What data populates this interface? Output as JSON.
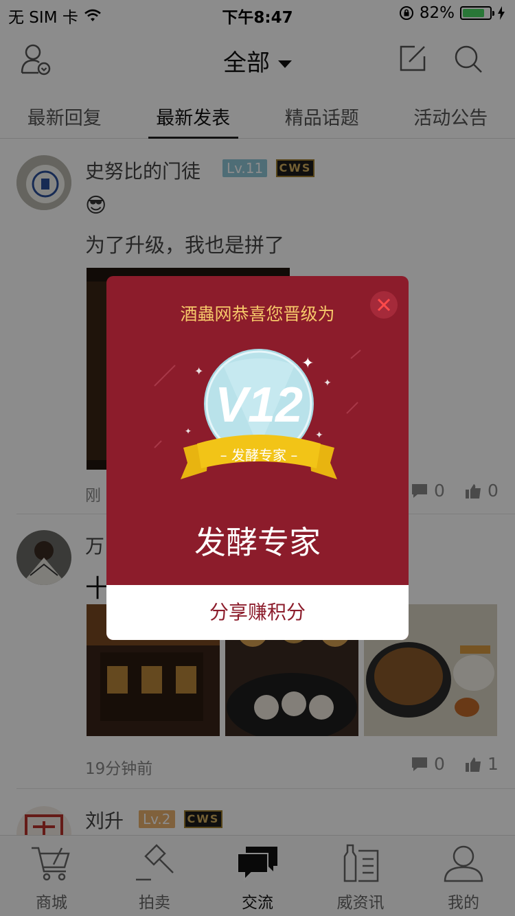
{
  "status_bar": {
    "carrier": "无 SIM 卡",
    "time": "下午8:47",
    "battery_text": "82%",
    "battery_level": 0.82,
    "icons": [
      "wifi-icon",
      "rotation-lock-icon",
      "battery-icon",
      "charging-icon"
    ]
  },
  "nav": {
    "title": "全部",
    "icons": [
      "user-icon",
      "edit-icon",
      "search-icon"
    ]
  },
  "tabs": [
    {
      "label": "最新回复",
      "active": false
    },
    {
      "label": "最新发表",
      "active": true
    },
    {
      "label": "精品话题",
      "active": false
    },
    {
      "label": "活动公告",
      "active": false
    }
  ],
  "posts": [
    {
      "username": "史努比的门徒",
      "level": "Lv.11",
      "badge": "CWS",
      "emoji": "😎",
      "text": "为了升级，我也是拼了",
      "time": "刚",
      "comments": "0",
      "likes": "0"
    },
    {
      "username": "万",
      "text": "十",
      "time": "19分钟前",
      "comments": "0",
      "likes": "1"
    },
    {
      "username": "刘升",
      "level": "Lv.2",
      "badge": "CWS"
    }
  ],
  "tabbar": [
    {
      "label": "商城",
      "icon": "cart-icon",
      "active": false
    },
    {
      "label": "拍卖",
      "icon": "gavel-icon",
      "active": false
    },
    {
      "label": "交流",
      "icon": "chat-icon",
      "active": true
    },
    {
      "label": "威资讯",
      "icon": "news-icon",
      "active": false
    },
    {
      "label": "我的",
      "icon": "profile-icon",
      "active": false
    }
  ],
  "modal": {
    "header": "酒蟲网恭喜您晋级为",
    "badge_level": "V12",
    "ribbon_text": "发酵专家",
    "title": "发酵专家",
    "footer_button": "分享赚积分"
  },
  "colors": {
    "modal_bg": "#8c1c2b",
    "header_gold": "#f6c86a",
    "ribbon_gold": "#f2c417",
    "level11": "#8ec6d8",
    "level2": "#e9b16d",
    "battery_green": "#4cd964"
  }
}
